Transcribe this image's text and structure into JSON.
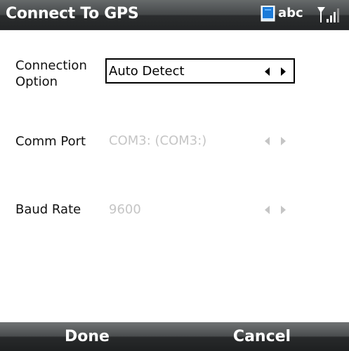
{
  "window": {
    "title": "Connect To GPS"
  },
  "status": {
    "input_mode": "abc",
    "icons": {
      "device": "device-icon",
      "signal": "signal-strength-icon"
    }
  },
  "fields": {
    "connection": {
      "label": "Connection\nOption",
      "value": "Auto Detect",
      "enabled": true
    },
    "comm_port": {
      "label": "Comm Port",
      "value": "COM3: (COM3:)",
      "enabled": false
    },
    "baud_rate": {
      "label": "Baud Rate",
      "value": "9600",
      "enabled": false
    }
  },
  "softkeys": {
    "left": "Done",
    "right": "Cancel"
  },
  "colors": {
    "bar_dark": "#222425",
    "bar_light": "#666a6b",
    "disabled_text": "#c5c5c5",
    "active_border": "#000000",
    "device_blue": "#1b7ad8"
  }
}
